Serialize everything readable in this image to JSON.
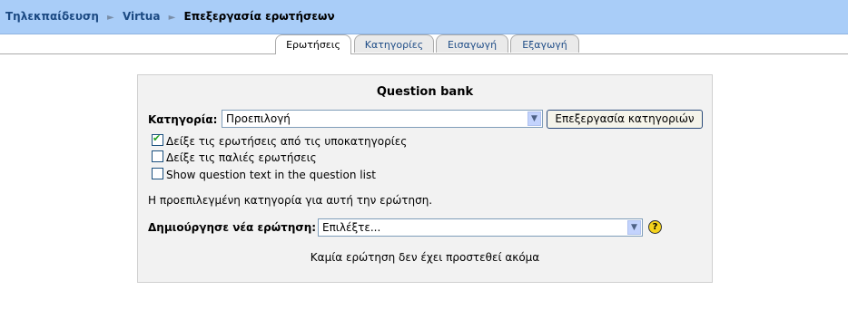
{
  "breadcrumb": {
    "items": [
      "Τηλεκπαίδευση",
      "Virtua"
    ],
    "current": "Επεξεργασία ερωτήσεων",
    "separator": "►"
  },
  "tabs": [
    {
      "label": "Ερωτήσεις",
      "active": true
    },
    {
      "label": "Κατηγορίες",
      "active": false
    },
    {
      "label": "Εισαγωγή",
      "active": false
    },
    {
      "label": "Εξαγωγή",
      "active": false
    }
  ],
  "panel": {
    "title": "Question bank",
    "category_label": "Κατηγορία:",
    "category_value": "Προεπιλογή",
    "edit_categories_button": "Επεξεργασία κατηγοριών",
    "checkboxes": [
      {
        "label": "Δείξε τις ερωτήσεις από τις υποκατηγορίες",
        "checked": true
      },
      {
        "label": "Δείξε τις παλιές ερωτήσεις",
        "checked": false
      },
      {
        "label": "Show question text in the question list",
        "checked": false
      }
    ],
    "category_info": "Η προεπιλεγμένη κατηγορία για αυτή την ερώτηση.",
    "create_label": "Δημιούργησε νέα ερώτηση:",
    "create_value": "Επιλέξτε...",
    "help_symbol": "?",
    "empty_message": "Καμία ερώτηση δεν έχει προστεθεί ακόμα"
  },
  "icons": {
    "dropdown": "▼",
    "checkmark": "✔"
  }
}
